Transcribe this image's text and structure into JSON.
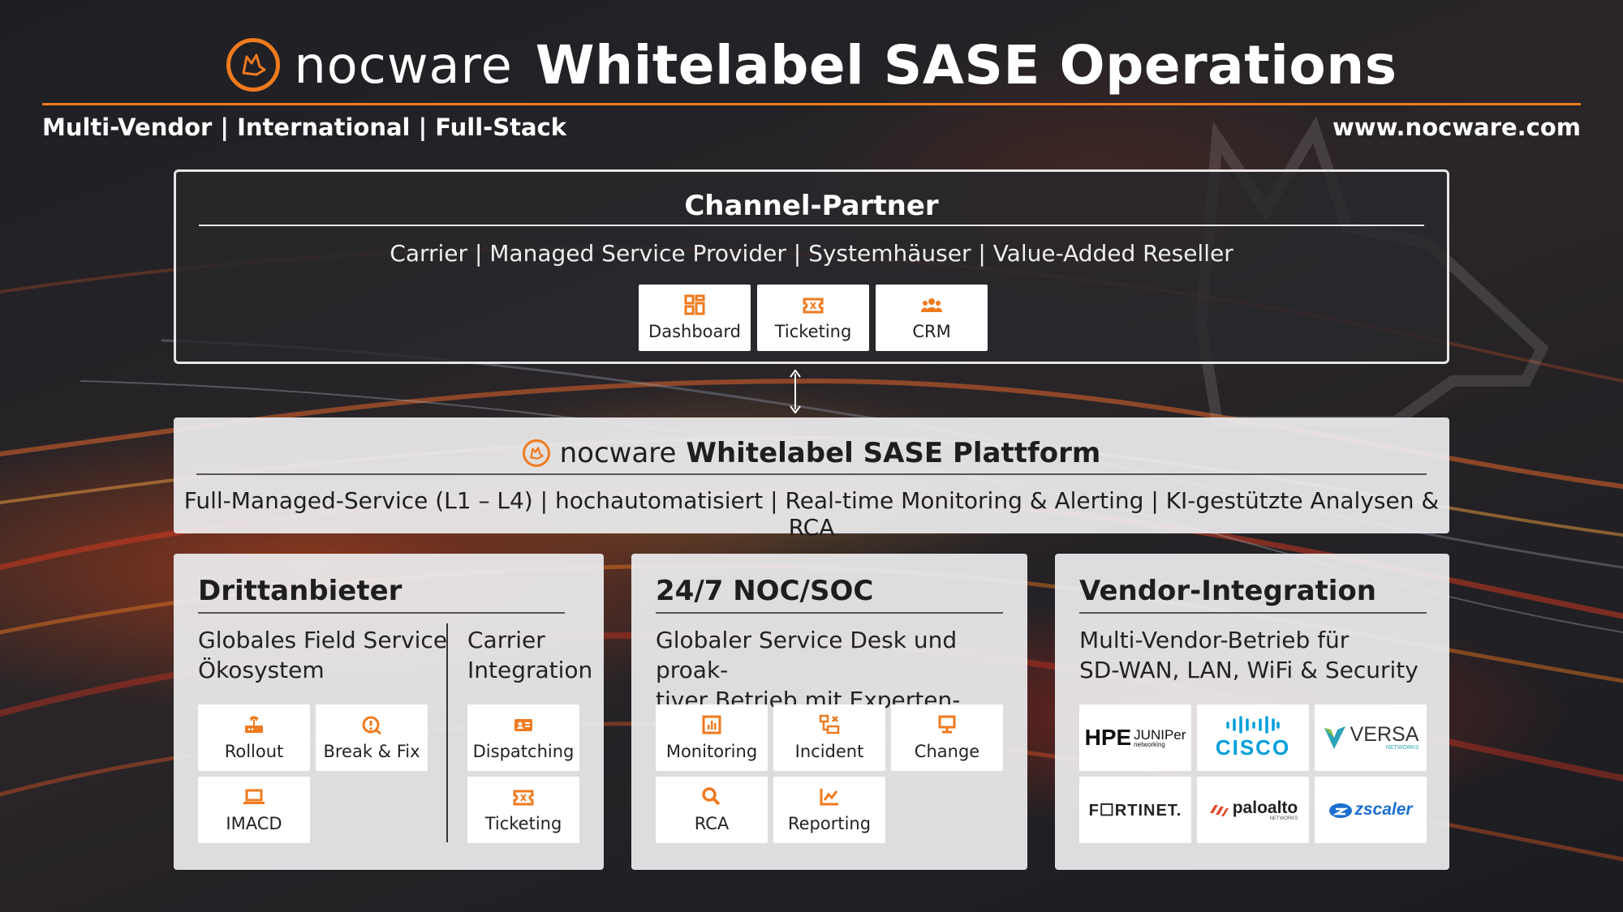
{
  "header": {
    "brand": "nocware",
    "title": "Whitelabel SASE Operations",
    "tagline": "Multi-Vendor | International | Full-Stack",
    "website": "www.nocware.com"
  },
  "channel_partner": {
    "title": "Channel-Partner",
    "subtitle": "Carrier | Managed Service Provider | Systemhäuser | Value-Added Reseller",
    "tiles": [
      {
        "label": "Dashboard",
        "icon": "dashboard-icon"
      },
      {
        "label": "Ticketing",
        "icon": "ticket-icon"
      },
      {
        "label": "CRM",
        "icon": "people-icon"
      }
    ]
  },
  "platform": {
    "brand": "nocware",
    "title": "Whitelabel SASE Plattform",
    "subtitle": "Full-Managed-Service (L1 – L4) | hochautomatisiert | Real-time Monitoring & Alerting | KI-gestützte Analysen & RCA"
  },
  "drittanbieter": {
    "title": "Drittanbieter",
    "left_desc_1": "Globales Field Service",
    "left_desc_2": "Ökosystem",
    "right_desc_1": "Carrier",
    "right_desc_2": "Integration",
    "left_tiles": [
      {
        "label": "Rollout",
        "icon": "router-icon"
      },
      {
        "label": "Break & Fix",
        "icon": "alert-clock-icon"
      },
      {
        "label": "IMACD",
        "icon": "laptop-icon"
      }
    ],
    "right_tiles": [
      {
        "label": "Dispatching",
        "icon": "dispatch-icon"
      },
      {
        "label": "Ticketing",
        "icon": "ticket-icon"
      }
    ]
  },
  "noc": {
    "title": "24/7 NOC/SOC",
    "desc_1": "Globaler Service Desk und proak-",
    "desc_2": "tiver Betrieb mit Experten-Teams",
    "tiles": [
      {
        "label": "Monitoring",
        "icon": "chart-icon"
      },
      {
        "label": "Incident",
        "icon": "incident-icon"
      },
      {
        "label": "Change",
        "icon": "monitor-icon"
      },
      {
        "label": "RCA",
        "icon": "search-icon"
      },
      {
        "label": "Reporting",
        "icon": "trend-icon"
      }
    ]
  },
  "vendor": {
    "title": "Vendor-Integration",
    "desc_1": "Multi-Vendor-Betrieb für",
    "desc_2": "SD-WAN, LAN, WiFi & Security",
    "logos": {
      "hpe": "HPE",
      "juniper": "JUNIPer",
      "juniper_sub": "networking",
      "cisco": "CISCO",
      "versa": "VERSA",
      "versa_sub": "NETWORKS",
      "fortinet": "F☐RTINET.",
      "paloalto": "paloalto",
      "paloalto_sub": "NETWORKS",
      "zscaler": "zscaler"
    }
  },
  "colors": {
    "accent": "#f07a1e",
    "panel_light": "#ececee",
    "panel_dark": "#28282c"
  }
}
